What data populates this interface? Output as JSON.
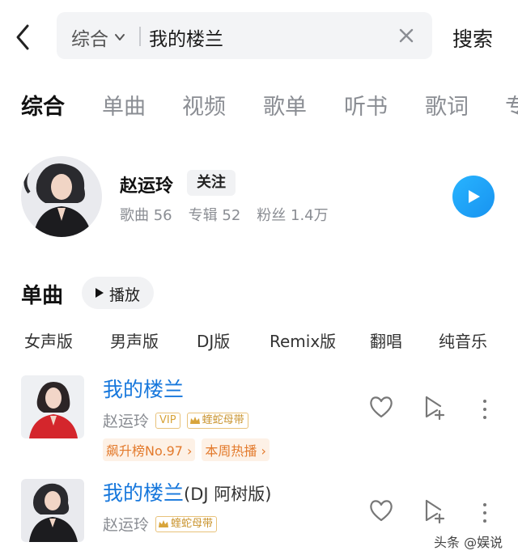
{
  "search": {
    "scope_label": "综合",
    "query": "我的楼兰",
    "submit_label": "搜索"
  },
  "tabs": [
    {
      "label": "综合",
      "active": true
    },
    {
      "label": "单曲",
      "active": false
    },
    {
      "label": "视频",
      "active": false
    },
    {
      "label": "歌单",
      "active": false
    },
    {
      "label": "听书",
      "active": false
    },
    {
      "label": "歌词",
      "active": false
    },
    {
      "label": "专",
      "active": false
    }
  ],
  "artist": {
    "name": "赵运玲",
    "follow_label": "关注",
    "songs_label": "歌曲 56",
    "albums_label": "专辑 52",
    "fans_label": "粉丝 1.4万"
  },
  "songs_section": {
    "title": "单曲",
    "play_label": "播放",
    "filters": [
      "女声版",
      "男声版",
      "DJ版",
      "Remix版",
      "翻唱",
      "纯音乐"
    ]
  },
  "songs": [
    {
      "title": "我的楼兰",
      "suffix": "",
      "singer": "赵运玲",
      "vip": "VIP",
      "tag": "蝰蛇母带",
      "ranks": [
        "飙升榜No.97",
        "本周热播"
      ]
    },
    {
      "title": "我的楼兰",
      "suffix": "(DJ 阿树版)",
      "singer": "赵运玲",
      "vip": "",
      "tag": "蝰蛇母带",
      "ranks": []
    }
  ],
  "watermark": "头条 @娱说",
  "colors": {
    "accent_blue": "#1677dc",
    "play_button": "#1f9cf5",
    "gold_badge": "#d8a43a",
    "rank_orange": "#e37a2c"
  }
}
